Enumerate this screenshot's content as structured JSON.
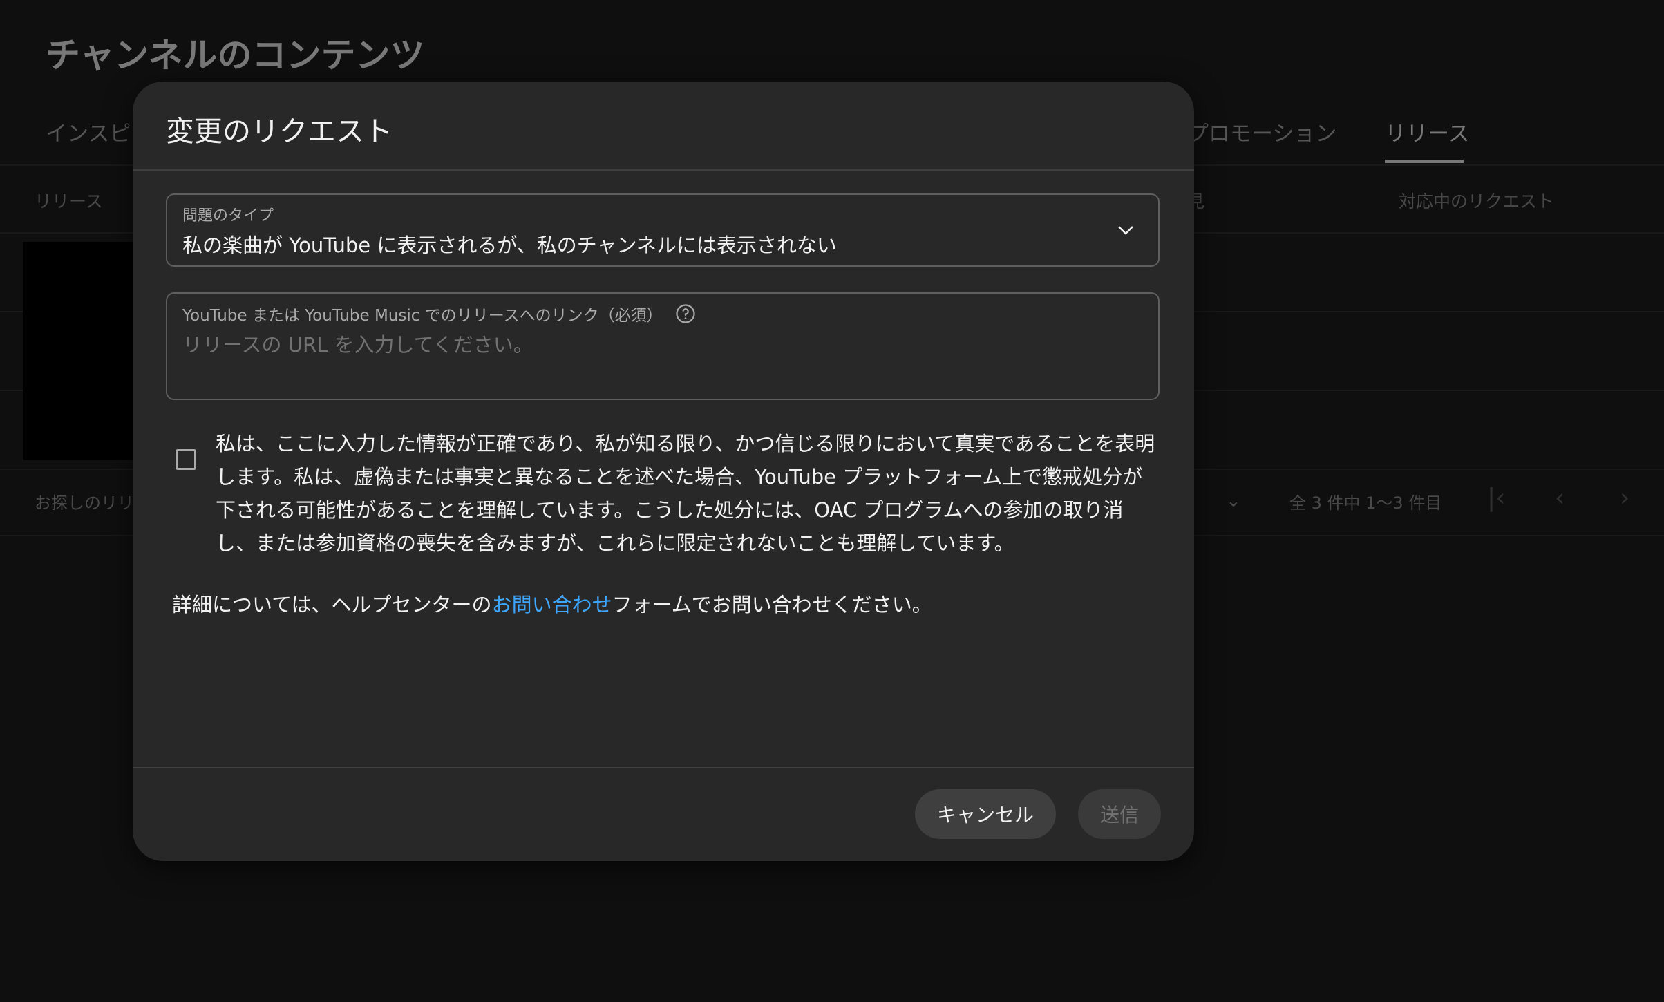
{
  "background": {
    "page_title": "チャンネルのコンテンツ",
    "tabs": [
      {
        "label": "インスピ"
      },
      {
        "label": "プロモーション"
      },
      {
        "label": "リリース"
      }
    ],
    "table_headers": {
      "release": "リリース",
      "view": "見",
      "pending_requests": "対応中のリクエスト"
    },
    "footer": {
      "search_hint": "お探しのリリ",
      "count_text": "全 3 件中 1〜3 件目"
    }
  },
  "dialog": {
    "title": "変更のリクエスト",
    "issue_type": {
      "label": "問題のタイプ",
      "value": "私の楽曲が YouTube に表示されるが、私のチャンネルには表示されない"
    },
    "release_link": {
      "label": "YouTube または YouTube Music でのリリースへのリンク（必須）",
      "placeholder": "リリースの URL を入力してください。",
      "value": ""
    },
    "consent": {
      "text": "私は、ここに入力した情報が正確であり、私が知る限り、かつ信じる限りにおいて真実であることを表明します。私は、虚偽または事実と異なることを述べた場合、YouTube プラットフォーム上で懲戒処分が下される可能性があることを理解しています。こうした処分には、OAC プログラムへの参加の取り消し、または参加資格の喪失を含みますが、これらに限定されないことも理解しています。",
      "checked": false
    },
    "help": {
      "prefix": "詳細については、ヘルプセンターの",
      "link": "お問い合わせ",
      "suffix": "フォームでお問い合わせください。"
    },
    "buttons": {
      "cancel": "キャンセル",
      "submit": "送信"
    }
  },
  "colors": {
    "link": "#3ea6ff",
    "dialog_bg": "#282828",
    "page_bg": "#1f1f1f"
  }
}
